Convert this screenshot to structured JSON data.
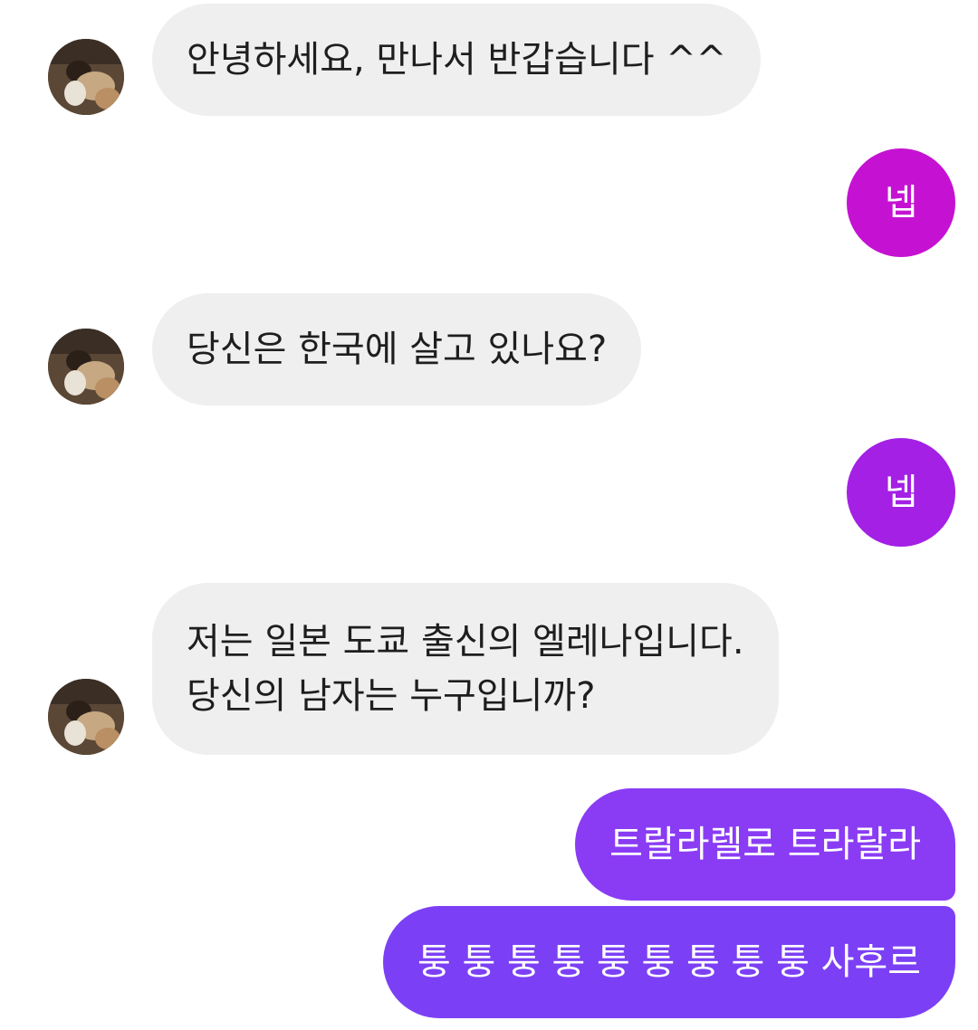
{
  "messages": [
    {
      "sender": "them",
      "text": "안녕하세요, 만나서 반갑습니다 ^^"
    },
    {
      "sender": "me",
      "text": "넵"
    },
    {
      "sender": "them",
      "text": "당신은 한국에 살고 있나요?"
    },
    {
      "sender": "me",
      "text": "넵"
    },
    {
      "sender": "them",
      "lines": [
        "저는 일본 도쿄 출신의 엘레나입니다.",
        "당신의 남자는 누구입니까?"
      ]
    },
    {
      "sender": "me",
      "text": "트랄라렐로 트라랄라"
    },
    {
      "sender": "me",
      "text": "퉁 퉁 퉁 퉁 퉁 퉁 퉁 퉁 퉁 사후르"
    }
  ],
  "colors": {
    "incoming_bubble": "#efefef",
    "incoming_text": "#1e1e1e",
    "outgoing_text": "#ffffff",
    "outgoing_gradient": [
      "#c512d2",
      "#a320e4",
      "#8a3cf4",
      "#7b40f5"
    ]
  },
  "icons": {
    "avatar": "contact-photo-icon"
  }
}
